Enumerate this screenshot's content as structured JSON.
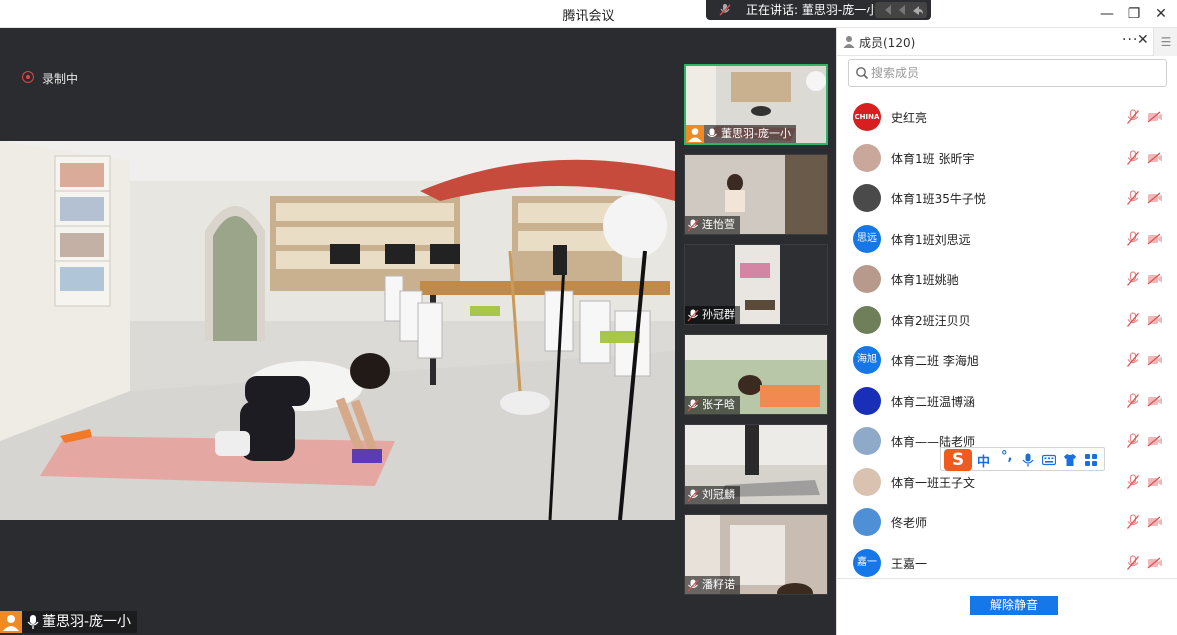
{
  "window": {
    "title": "腾讯会议",
    "speaking_text": "正在讲话: 董思羽-庞一小;",
    "controls": [
      "—",
      "❐",
      "✕"
    ]
  },
  "stage": {
    "recording_label": "录制中",
    "active_speaker": "董思羽-庞一小"
  },
  "thumbnails": [
    {
      "name": "董思羽-庞一小",
      "active": true,
      "mic": "on"
    },
    {
      "name": "连怡萱",
      "active": false,
      "mic": "off"
    },
    {
      "name": "孙冠群",
      "active": false,
      "mic": "off"
    },
    {
      "name": "张子晗",
      "active": false,
      "mic": "off"
    },
    {
      "name": "刘冠麟",
      "active": false,
      "mic": "off"
    },
    {
      "name": "潘籽诺",
      "active": false,
      "mic": "off"
    }
  ],
  "panel": {
    "title": "成员(120)",
    "more_label": "···",
    "close_label": "✕",
    "menu_label": "☰",
    "search_placeholder": "搜索成员",
    "members": [
      {
        "name": "史红亮",
        "avatar_text": "CHINA",
        "avatar_color": "#d81e1e"
      },
      {
        "name": "体育1班 张昕宇",
        "avatar_text": "",
        "avatar_color": "#c9a79b"
      },
      {
        "name": "体育1班35牛子悦",
        "avatar_text": "",
        "avatar_color": "#4a4a4a"
      },
      {
        "name": "体育1班刘思远",
        "avatar_text": "思远",
        "avatar_color": "#1677e8"
      },
      {
        "name": "体育1班姚驰",
        "avatar_text": "",
        "avatar_color": "#b89a8c"
      },
      {
        "name": "体育2班汪贝贝",
        "avatar_text": "",
        "avatar_color": "#6e7f5a"
      },
      {
        "name": "体育二班 李海旭",
        "avatar_text": "海旭",
        "avatar_color": "#1677e8"
      },
      {
        "name": "体育二班温博涵",
        "avatar_text": "",
        "avatar_color": "#1a2fb8"
      },
      {
        "name": "体育——陆老师",
        "avatar_text": "",
        "avatar_color": "#8fa9c8"
      },
      {
        "name": "体育一班王子文",
        "avatar_text": "",
        "avatar_color": "#d9c2b0"
      },
      {
        "name": "佟老师",
        "avatar_text": "",
        "avatar_color": "#4f8fd6"
      },
      {
        "name": "王嘉一",
        "avatar_text": "嘉一",
        "avatar_color": "#1677e8"
      }
    ],
    "unmute_button": "解除静音"
  },
  "ime": {
    "logo": "S",
    "mode": "中",
    "punct": "°,"
  },
  "colors": {
    "accent_blue": "#1677e8",
    "active_green": "#2fb56a",
    "record_red": "#e04646",
    "stage_bg": "#2a2c30",
    "muted_red": "#e05050"
  }
}
